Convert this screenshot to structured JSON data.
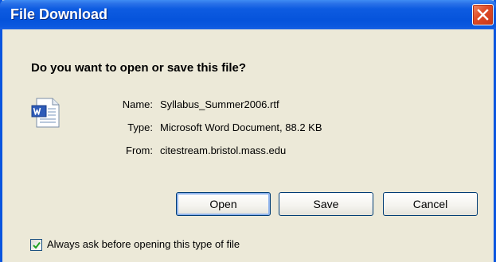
{
  "window": {
    "title": "File Download"
  },
  "dialog": {
    "question": "Do you want to open or save this file?",
    "file_icon": "word-document-icon",
    "fields": {
      "name_label": "Name:",
      "name_value": "Syllabus_Summer2006.rtf",
      "type_label": "Type:",
      "type_value": "Microsoft Word Document, 88.2 KB",
      "from_label": "From:",
      "from_value": "citestream.bristol.mass.edu"
    },
    "buttons": {
      "open": "Open",
      "save": "Save",
      "cancel": "Cancel"
    },
    "always_ask": {
      "label": "Always ask before opening this type of file",
      "checked": true
    }
  },
  "colors": {
    "titlebar": "#0553DB",
    "window_bg": "#ECE9D8",
    "close_button": "#DE4A25"
  }
}
